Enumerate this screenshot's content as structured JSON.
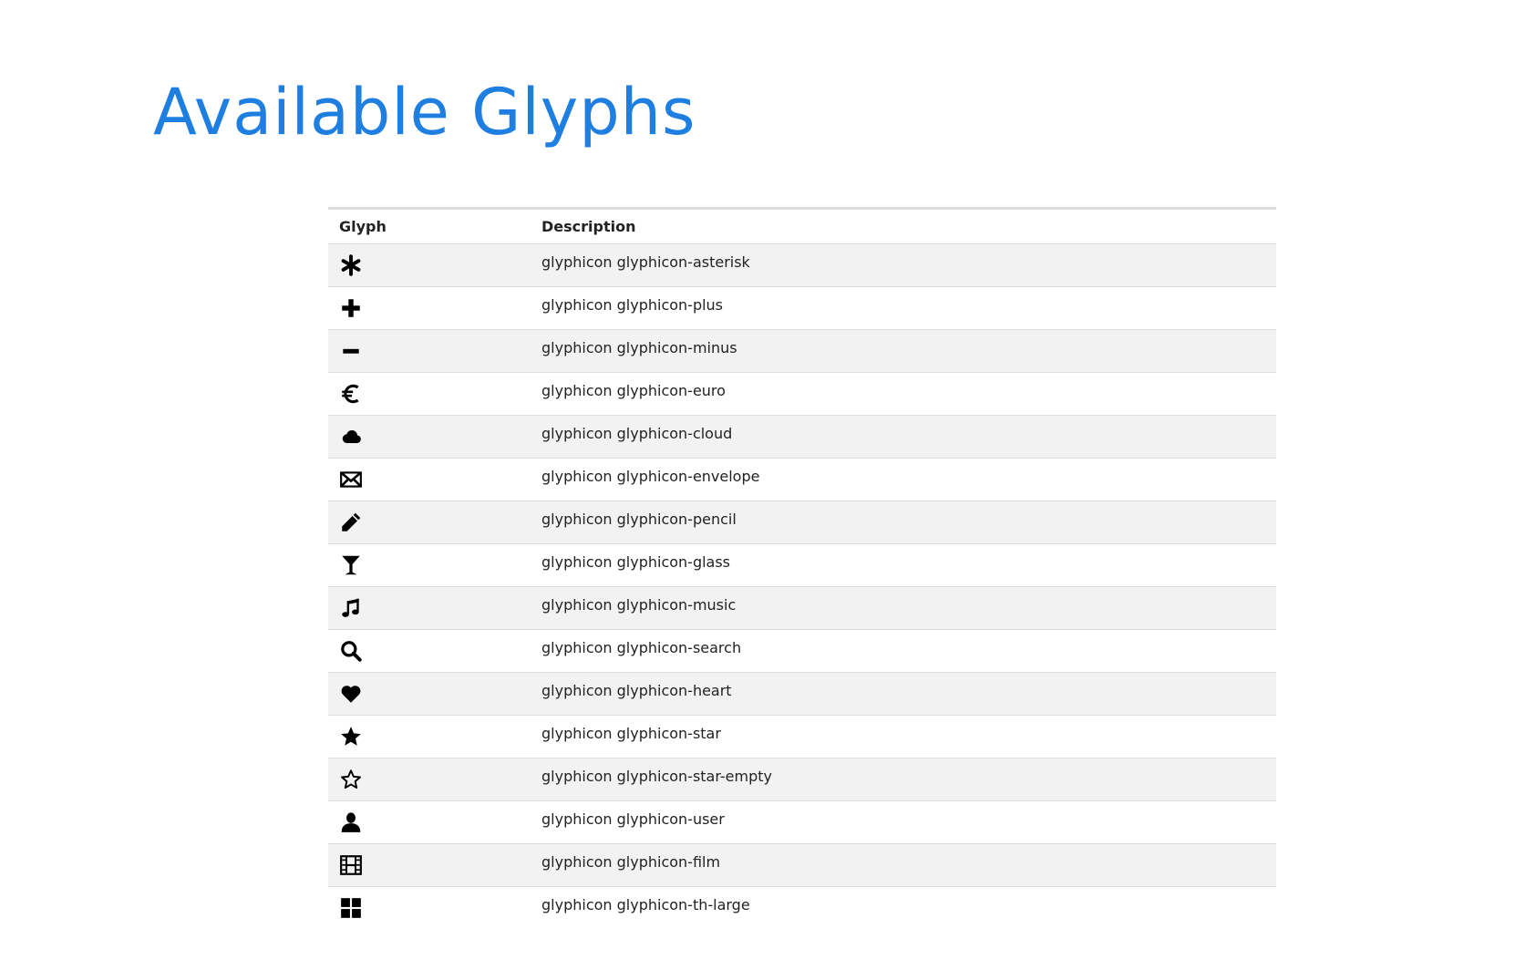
{
  "title": "Available Glyphs",
  "table": {
    "headers": {
      "glyph": "Glyph",
      "description": "Description"
    },
    "rows": [
      {
        "icon": "asterisk-icon",
        "description": "glyphicon glyphicon-asterisk"
      },
      {
        "icon": "plus-icon",
        "description": "glyphicon glyphicon-plus"
      },
      {
        "icon": "minus-icon",
        "description": "glyphicon glyphicon-minus"
      },
      {
        "icon": "euro-icon",
        "description": "glyphicon glyphicon-euro"
      },
      {
        "icon": "cloud-icon",
        "description": "glyphicon glyphicon-cloud"
      },
      {
        "icon": "envelope-icon",
        "description": "glyphicon glyphicon-envelope"
      },
      {
        "icon": "pencil-icon",
        "description": "glyphicon glyphicon-pencil"
      },
      {
        "icon": "glass-icon",
        "description": "glyphicon glyphicon-glass"
      },
      {
        "icon": "music-icon",
        "description": "glyphicon glyphicon-music"
      },
      {
        "icon": "search-icon",
        "description": "glyphicon glyphicon-search"
      },
      {
        "icon": "heart-icon",
        "description": "glyphicon glyphicon-heart"
      },
      {
        "icon": "star-icon",
        "description": "glyphicon glyphicon-star"
      },
      {
        "icon": "star-empty-icon",
        "description": "glyphicon glyphicon-star-empty"
      },
      {
        "icon": "user-icon",
        "description": "glyphicon glyphicon-user"
      },
      {
        "icon": "film-icon",
        "description": "glyphicon glyphicon-film"
      },
      {
        "icon": "th-large-icon",
        "description": "glyphicon glyphicon-th-large"
      }
    ]
  },
  "colors": {
    "title": "#1f7fe0",
    "row_stripe": "#f2f2f2",
    "border": "#dddddd"
  }
}
